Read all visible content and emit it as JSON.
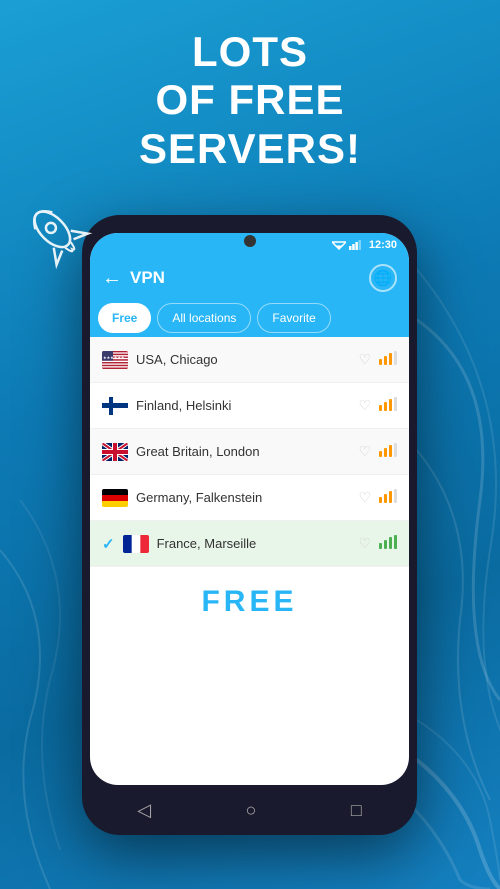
{
  "background": {
    "gradient_start": "#1a9fd4",
    "gradient_end": "#0a6ba0"
  },
  "headline": {
    "line1": "Lots",
    "line2": "of free",
    "line3": "servers!"
  },
  "status_bar": {
    "time": "12:30"
  },
  "nav_bar": {
    "title": "VPN"
  },
  "tabs": [
    {
      "label": "Free",
      "active": true
    },
    {
      "label": "All locations",
      "active": false
    },
    {
      "label": "Favorite",
      "active": false
    }
  ],
  "servers": [
    {
      "country": "USA, Chicago",
      "flag": "usa",
      "selected": false,
      "signal": "orange"
    },
    {
      "country": "Finland, Helsinki",
      "flag": "finland",
      "selected": false,
      "signal": "orange"
    },
    {
      "country": "Great Britain, London",
      "flag": "uk",
      "selected": false,
      "signal": "orange"
    },
    {
      "country": "Germany, Falkenstein",
      "flag": "germany",
      "selected": false,
      "signal": "orange"
    },
    {
      "country": "France, Marseille",
      "flag": "france",
      "selected": true,
      "signal": "green"
    }
  ],
  "free_badge": "FREE",
  "bottom_nav": {
    "back": "◁",
    "home": "○",
    "recent": "□"
  }
}
